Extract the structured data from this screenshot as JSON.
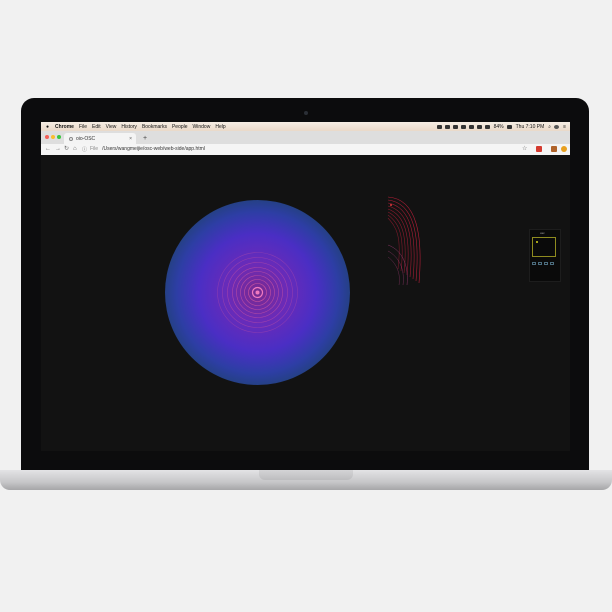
{
  "menubar": {
    "app_name": "Chrome",
    "items": [
      "File",
      "Edit",
      "View",
      "History",
      "Bookmarks",
      "People",
      "Window",
      "Help"
    ],
    "battery": "84%",
    "clock": "Thu 7:10 PM"
  },
  "browser": {
    "tab_title": "oio-OSC",
    "tab_close": "×",
    "new_tab": "+",
    "url_prefix": "File",
    "url": "/Users/wangmeijie/osc-web/web-side/app.html",
    "bookmark_star": "☆"
  },
  "content": {
    "panel_title": "osc"
  },
  "dock": {
    "icons": [
      {
        "name": "finder-icon",
        "color": "#3a8ee6"
      },
      {
        "name": "siri-icon",
        "color": "#6c4ad6"
      },
      {
        "name": "launchpad-icon",
        "color": "#9aa3ad"
      },
      {
        "name": "safari-icon",
        "color": "#2f8fe0"
      },
      {
        "name": "preview-icon",
        "color": "#5a8fc6"
      },
      {
        "name": "calendar-icon",
        "color": "#ffffff"
      },
      {
        "name": "notes-icon",
        "color": "#f6e27a"
      },
      {
        "name": "reminders-icon",
        "color": "#f4f4f4"
      },
      {
        "name": "photos-icon",
        "color": "#e27b4c"
      },
      {
        "name": "pages-icon",
        "color": "#ef9a3c"
      },
      {
        "name": "numbers-icon",
        "color": "#3fb85b"
      },
      {
        "name": "itunes-icon",
        "color": "#e05aa3"
      },
      {
        "name": "ibooks-icon",
        "color": "#f19a35"
      },
      {
        "name": "app-store-icon",
        "color": "#2f8fe6"
      },
      {
        "name": "system-preferences-icon",
        "color": "#7f8a95"
      },
      {
        "name": "outlook-icon",
        "color": "#2b6fc7"
      },
      {
        "name": "sketch-icon",
        "color": "#f4b63b"
      },
      {
        "name": "xmind-icon",
        "color": "#f2f2f2"
      },
      {
        "name": "netease-music-icon",
        "color": "#d7252c"
      },
      {
        "name": "chrome-icon",
        "color": "#4caf50"
      },
      {
        "name": "terminal-icon",
        "color": "#2b2b2b"
      },
      {
        "name": "vscode-icon",
        "color": "#2d7ad6"
      },
      {
        "name": "wechat-icon",
        "color": "#3cbf3c"
      },
      {
        "name": "folder-icon",
        "color": "#e9e2d6"
      },
      {
        "name": "screen-icon",
        "color": "#3a3a3a"
      },
      {
        "name": "document-icon",
        "color": "#ffffff"
      },
      {
        "name": "document-icon",
        "color": "#f3f3f3"
      },
      {
        "name": "stack-icon",
        "color": "#dcdcdc"
      },
      {
        "name": "stack-icon",
        "color": "#d0d0d0"
      },
      {
        "name": "trash-icon",
        "color": "#c8c8c8"
      }
    ]
  }
}
